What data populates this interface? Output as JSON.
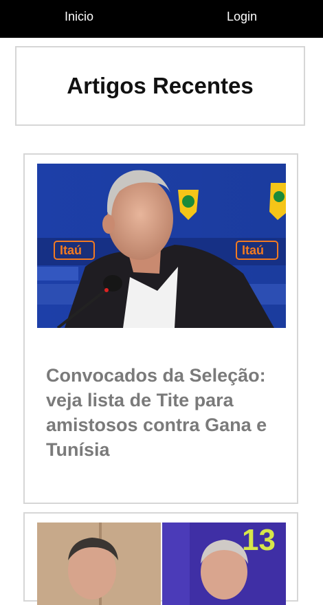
{
  "nav": {
    "home_label": "Inicio",
    "login_label": "Login"
  },
  "page": {
    "title": "Artigos Recentes"
  },
  "articles": [
    {
      "headline": "Convocados da Seleção: veja lista de Tite para amistosos contra Gana e Tunísia",
      "image": "coach-press-conference-photo"
    },
    {
      "image": "two-politicians-photo",
      "badge_text": "13"
    }
  ],
  "sponsors": {
    "banner_text": "Itaú"
  },
  "colors": {
    "topbar": "#000000",
    "headline": "#7a7a7a",
    "border": "#d6d6d6"
  }
}
